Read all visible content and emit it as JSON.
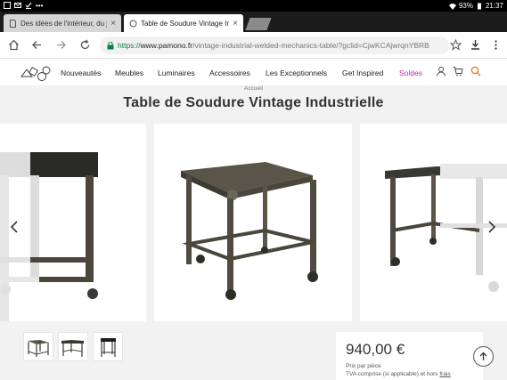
{
  "status_bar": {
    "battery": "93%",
    "time": "21:37"
  },
  "tabs": [
    {
      "title": "Des idées de l'intérieur, du jo",
      "close": "×"
    },
    {
      "title": "Table de Soudure Vintage In",
      "close": "×"
    }
  ],
  "toolbar": {
    "url_scheme": "https://",
    "url_host": "www.pamono.fr",
    "url_path": "/vintage-industrial-welded-mechanics-table/?gclid=CjwKCAjwrqnYBRB"
  },
  "nav": {
    "items": [
      "Nouveautés",
      "Meubles",
      "Luminaires",
      "Accessoires",
      "Les Exceptionnels",
      "Get Inspired",
      "Soldes"
    ]
  },
  "breadcrumb": "Accueil",
  "product": {
    "title": "Table de Soudure Vintage Industrielle",
    "price": "940,00 €",
    "price_unit": "Prix par pièce",
    "tax_note": "TVA comprise (si applicable) et hors",
    "tax_link": "frais"
  },
  "colors": {
    "sale": "#c02aa7",
    "secure": "#0b8043",
    "metal": "#4a463c"
  },
  "icons": [
    "home-icon",
    "back-icon",
    "forward-icon",
    "reload-icon",
    "lock-icon",
    "star-icon",
    "download-icon",
    "menu-icon",
    "user-icon",
    "cart-icon",
    "search-icon",
    "chevron-left-icon",
    "chevron-right-icon",
    "arrow-up-icon"
  ]
}
